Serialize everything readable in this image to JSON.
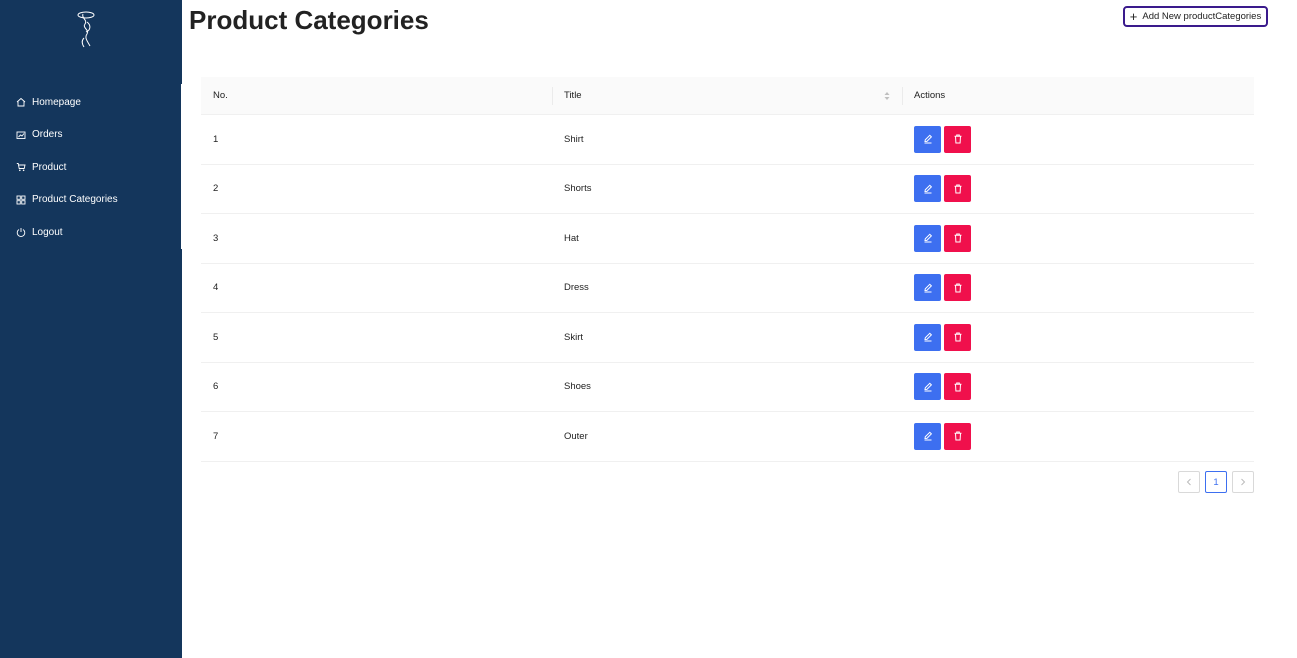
{
  "sidebar": {
    "items": [
      {
        "label": "Homepage",
        "icon": "home-icon"
      },
      {
        "label": "Orders",
        "icon": "chart-icon"
      },
      {
        "label": "Product",
        "icon": "cart-icon"
      },
      {
        "label": "Product Categories",
        "icon": "grid-icon"
      },
      {
        "label": "Logout",
        "icon": "power-icon"
      }
    ]
  },
  "header": {
    "title": "Product Categories",
    "add_button_label": "Add New productCategories"
  },
  "table": {
    "columns": [
      "No.",
      "Title",
      "Actions"
    ],
    "rows": [
      {
        "no": "1",
        "title": "Shirt"
      },
      {
        "no": "2",
        "title": "Shorts"
      },
      {
        "no": "3",
        "title": "Hat"
      },
      {
        "no": "4",
        "title": "Dress"
      },
      {
        "no": "5",
        "title": "Skirt"
      },
      {
        "no": "6",
        "title": "Shoes"
      },
      {
        "no": "7",
        "title": "Outer"
      }
    ]
  },
  "pagination": {
    "current_page": "1",
    "prev_icon": "chevron-left-icon",
    "next_icon": "chevron-right-icon"
  },
  "colors": {
    "sidebar_bg": "#14365c",
    "edit_button": "#3d6ff0",
    "delete_button": "#f0104c",
    "add_button_border": "#3a1a8c"
  }
}
